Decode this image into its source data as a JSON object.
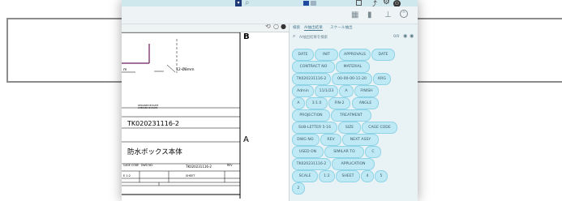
{
  "toolbar": {
    "search_icon": "search-icon",
    "right_icons": [
      "box-icon",
      "share-icon",
      "gear-icon",
      "user-icon"
    ]
  },
  "drawing": {
    "zone_b": "B",
    "zone_a": "A",
    "dim_left": "m",
    "dim_right": "12-Ø8mm",
    "small_text1": "DESIGNED BY/DATE",
    "small_text2": "CHECKED BY/DATE",
    "part_number": "TK020231116-2",
    "title_jp": "防水ボックス本体",
    "row1_c1": "CAGE CODE",
    "row1_c2": "DWG NO.",
    "row1_c3": "TK020231116-2",
    "row1_c4": "REV",
    "row2_c1": "E 1:2",
    "row2_c2": "SHEET"
  },
  "panel": {
    "tabs": [
      "検索",
      "AI抽出結果",
      "スケール抽出"
    ],
    "search_text": "AI抽出結果を検索",
    "count": "0/0",
    "chips": [
      "DATE",
      "INIT",
      "APPROVALS",
      "DATE",
      "CONTRACT NO",
      "MATERIAL",
      "TK020231116-2",
      "00-00-00-11-20",
      "KRG",
      "Admin",
      "11/1/23",
      "A",
      "FINISH",
      "A",
      "3:1.0",
      "FIN-2",
      "ANGLE",
      "PROJECTION",
      "TREATMENT",
      "SUB-LETTER 5-16",
      "SIZE",
      "CAGE CODE",
      "DWG NO.",
      "REV",
      "NEXT ASSY",
      "USED ON",
      "SIMILAR TO",
      "C",
      "TK020231116-2",
      "APPLICATION",
      "SCALE",
      "1:2",
      "SHEET",
      "4",
      "5",
      "2"
    ]
  }
}
